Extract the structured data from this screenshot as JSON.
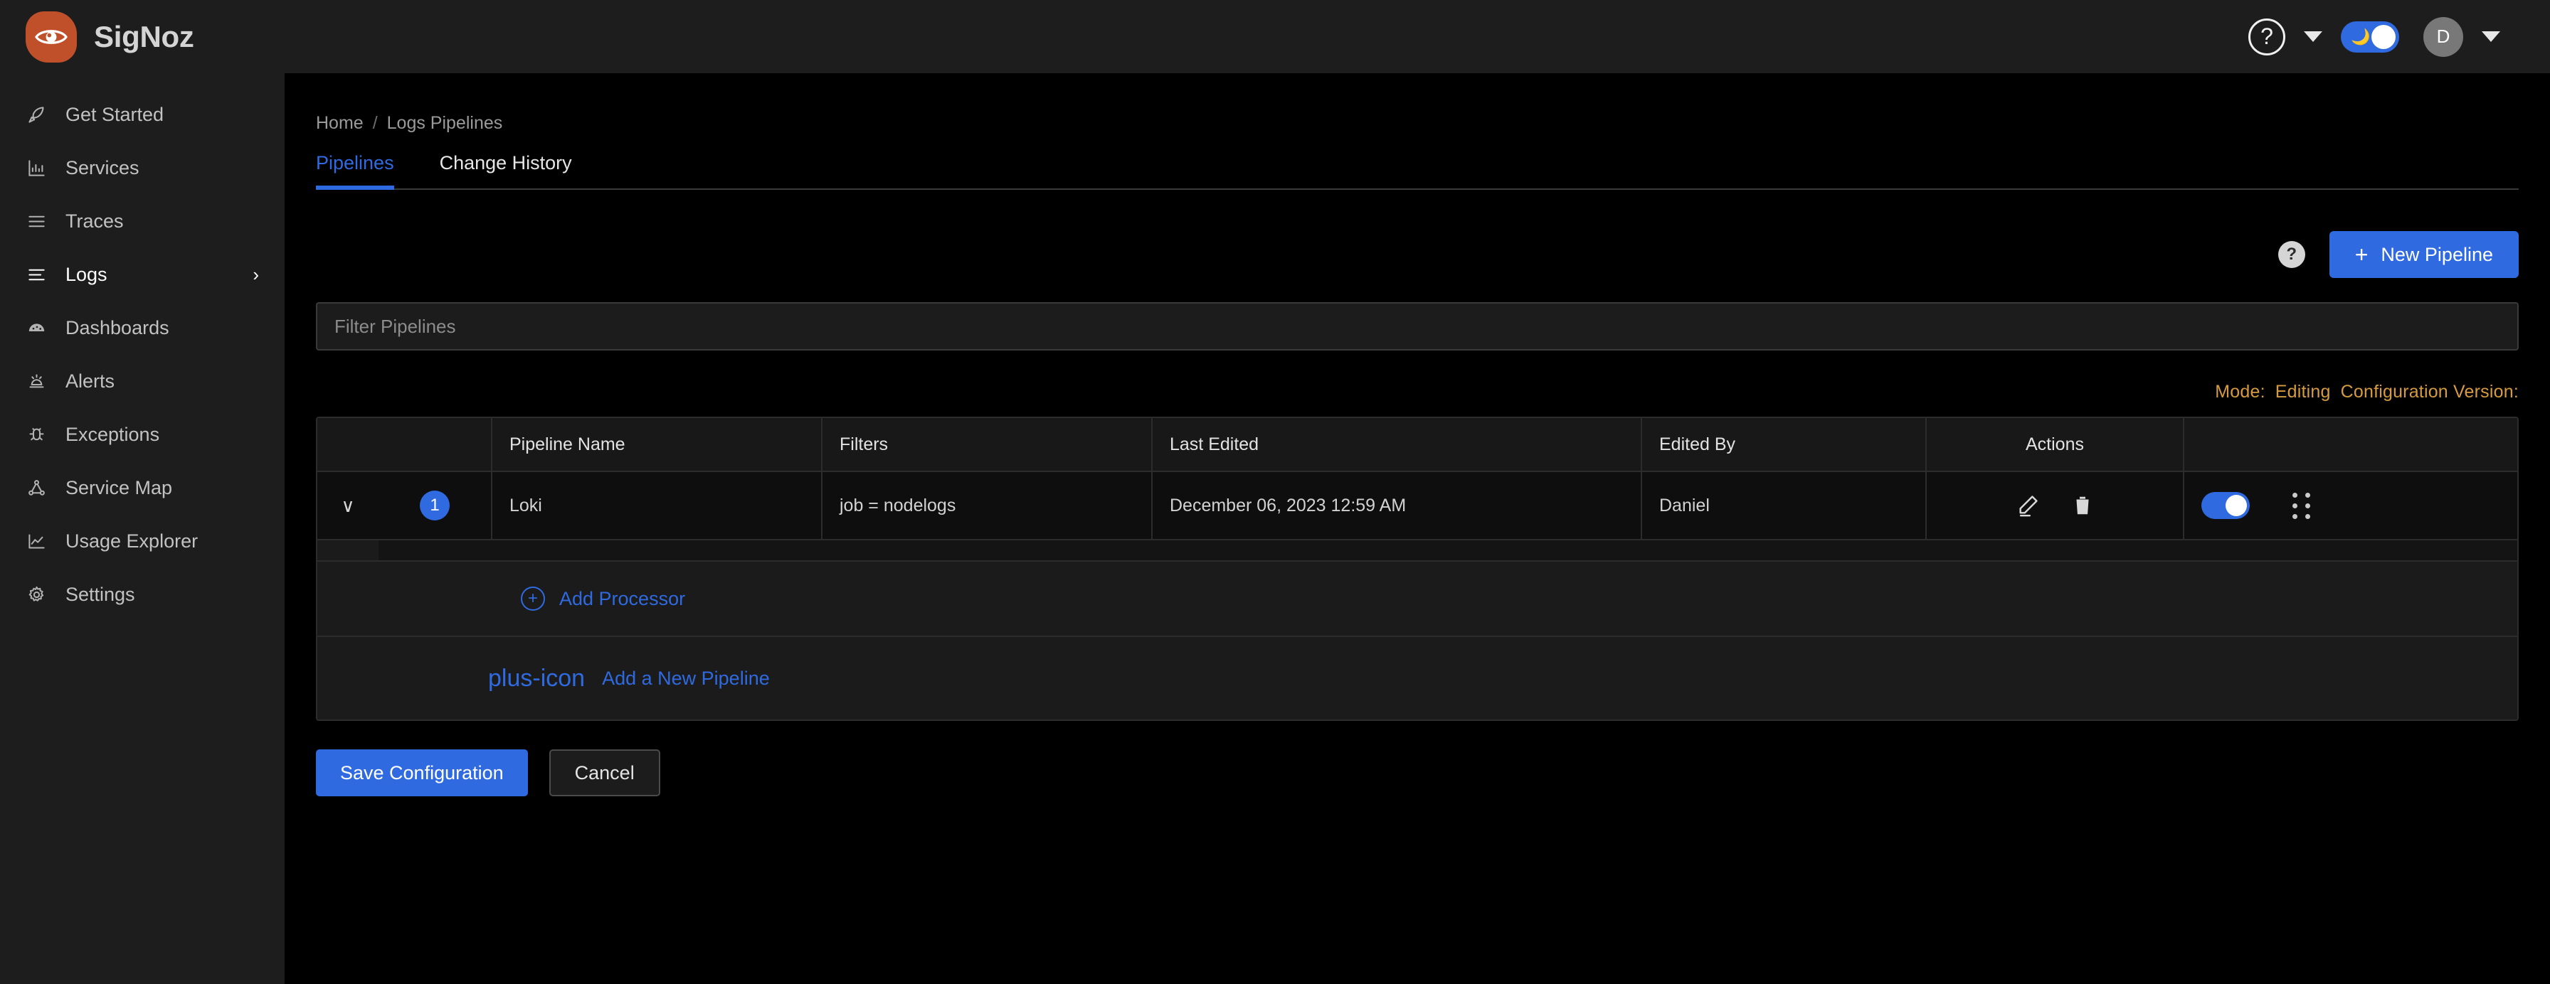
{
  "brand": {
    "name": "SigNoz",
    "logo_icon": "eye-logo-icon",
    "logo_color": "#c0502a"
  },
  "topbar": {
    "help_icon": "question-circle-icon",
    "help_caret_icon": "chevron-down-icon",
    "theme_toggle": {
      "icon": "moon-icon",
      "glyph": "🌙",
      "state": "on",
      "color": "#2f6ae0"
    },
    "avatar_initial": "D",
    "avatar_caret_icon": "chevron-down-icon"
  },
  "sidebar": {
    "items": [
      {
        "label": "Get Started",
        "icon": "rocket-icon",
        "active": false
      },
      {
        "label": "Services",
        "icon": "bar-chart-icon",
        "active": false
      },
      {
        "label": "Traces",
        "icon": "align-justify-icon",
        "active": false
      },
      {
        "label": "Logs",
        "icon": "log-lines-icon",
        "active": true,
        "chevron": "›"
      },
      {
        "label": "Dashboards",
        "icon": "gauge-icon",
        "active": false
      },
      {
        "label": "Alerts",
        "icon": "siren-icon",
        "active": false
      },
      {
        "label": "Exceptions",
        "icon": "bug-icon",
        "active": false
      },
      {
        "label": "Service Map",
        "icon": "network-nodes-icon",
        "active": false
      },
      {
        "label": "Usage Explorer",
        "icon": "line-chart-icon",
        "active": false
      },
      {
        "label": "Settings",
        "icon": "gear-icon",
        "active": false
      }
    ]
  },
  "main": {
    "breadcrumb": {
      "home": "Home",
      "separator": "/",
      "current": "Logs Pipelines"
    },
    "tabs": [
      {
        "label": "Pipelines",
        "active": true
      },
      {
        "label": "Change History",
        "active": false
      }
    ],
    "toolbar": {
      "help_badge": "?",
      "new_pipeline_label": "New Pipeline",
      "new_pipeline_plus": "+"
    },
    "filter": {
      "placeholder": "Filter Pipelines",
      "value": ""
    },
    "status": {
      "mode_label": "Mode:",
      "mode_value": "Editing",
      "version_label": "Configuration Version:",
      "color": "#d69b3f"
    },
    "table": {
      "columns": [
        "Pipeline Name",
        "Filters",
        "Last Edited",
        "Edited By",
        "Actions"
      ],
      "rows": [
        {
          "expand_icon": "chevron-down-icon",
          "order": "1",
          "pipeline_name": "Loki",
          "filters": "job = nodelogs",
          "last_edited": "December 06, 2023 12:59 AM",
          "edited_by": "Daniel",
          "actions": {
            "edit_icon": "pencil-icon",
            "delete_icon": "trash-icon",
            "enabled_toggle": "on",
            "drag_icon": "drag-handle-icon"
          }
        }
      ],
      "add_processor_label": "Add Processor",
      "add_processor_icon": "circle-plus-icon",
      "add_pipeline_label": "Add a New Pipeline",
      "add_pipeline_icon": "plus-icon"
    },
    "footer": {
      "save_label": "Save Configuration",
      "cancel_label": "Cancel"
    }
  }
}
